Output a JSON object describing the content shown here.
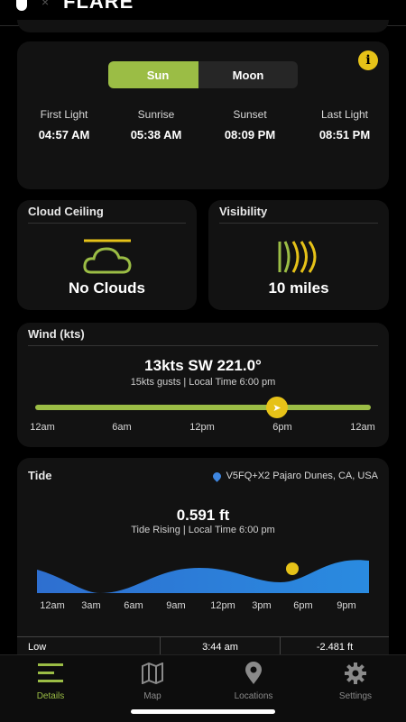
{
  "app": {
    "brand": "FLARE",
    "separator": "×"
  },
  "sun_moon": {
    "tabs": [
      "Sun",
      "Moon"
    ],
    "active_tab": "Sun",
    "info_label": "i",
    "times": [
      {
        "label": "First Light",
        "value": "04:57 AM"
      },
      {
        "label": "Sunrise",
        "value": "05:38 AM"
      },
      {
        "label": "Sunset",
        "value": "08:09 PM"
      },
      {
        "label": "Last Light",
        "value": "08:51 PM"
      }
    ]
  },
  "cloud": {
    "title": "Cloud Ceiling",
    "value": "No Clouds",
    "icon": "cloud-icon"
  },
  "visibility": {
    "title": "Visibility",
    "value": "10 miles",
    "icon": "visibility-waves-icon"
  },
  "wind": {
    "title": "Wind (kts)",
    "summary": "13kts SW 221.0°",
    "detail": "15kts gusts | Local Time 6:00 pm",
    "slider_position": 0.72,
    "ticks": [
      "12am",
      "6am",
      "12pm",
      "6pm",
      "12am"
    ]
  },
  "tide": {
    "title": "Tide",
    "location": "V5FQ+X2 Pajaro Dunes, CA, USA",
    "height": "0.591 ft",
    "detail": "Tide Rising | Local Time 6:00 pm",
    "ticks": [
      "12am",
      "3am",
      "6am",
      "9am",
      "12pm",
      "3pm",
      "6pm",
      "9pm"
    ],
    "row": {
      "type": "Low",
      "time": "3:44 am",
      "height": "-2.481 ft"
    }
  },
  "colors": {
    "accent_green": "#9BBD45",
    "accent_yellow": "#E6C218",
    "tide_blue": "#2E6FD0"
  },
  "nav": [
    {
      "label": "Details",
      "icon": "details-icon",
      "active": true
    },
    {
      "label": "Map",
      "icon": "map-icon",
      "active": false
    },
    {
      "label": "Locations",
      "icon": "location-pin-icon",
      "active": false
    },
    {
      "label": "Settings",
      "icon": "gear-icon",
      "active": false
    }
  ]
}
